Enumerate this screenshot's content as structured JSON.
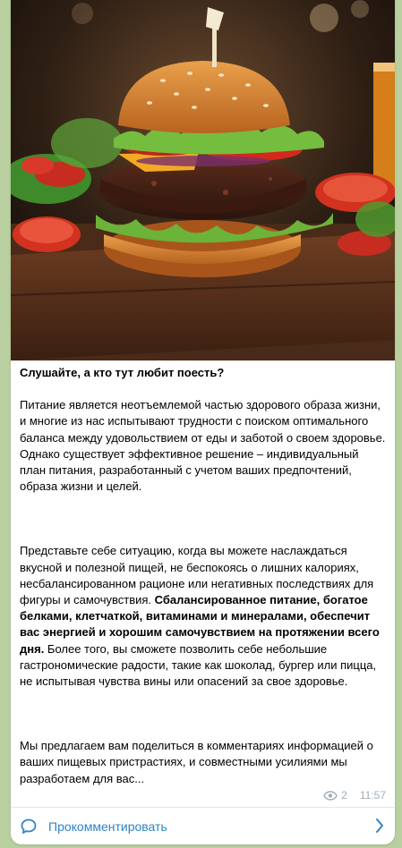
{
  "post": {
    "title": "Слушайте, а кто тут любит поесть?",
    "p1": "Питание является неотъемлемой частью здорового образа жизни, и многие из нас испытывают трудности с поиском оптимального баланса между удовольствием от еды и заботой о своем здоровье. Однако существует эффективное решение – индивидуальный план питания, разработанный с учетом ваших предпочтений, образа жизни и целей.",
    "p2_start": "Представьте себе ситуацию, когда вы можете наслаждаться вкусной и полезной пищей, не беспокоясь о лишних калориях, несбалансированном рационе или негативных последствиях для фигуры и самочувствия. ",
    "p2_bold": "Сбалансированное питание, богатое белками, клетчаткой, витаминами и минералами, обеспечит вас энергией и хорошим самочувствием на протяжении всего дня.",
    "p2_end": " Более того, вы сможете позволить себе небольшие гастрономические радости, такие как шоколад, бургер или пицца, не испытывая чувства вины или опасений за свое здоровье.",
    "p3": "Мы предлагаем вам поделиться в комментариях информацией о ваших пищевых пристрастиях, и совместными усилиями мы разработаем для вас...",
    "views": "2",
    "time": "11:57"
  },
  "footer": {
    "comment_label": "Прокомментировать"
  },
  "icons": {
    "views": "eye-icon",
    "comment": "speech-bubble-icon",
    "chevron": "chevron-right-icon"
  },
  "colors": {
    "accent": "#2f84c4",
    "meta": "#a0acb6",
    "background": "#b9cfa0"
  }
}
